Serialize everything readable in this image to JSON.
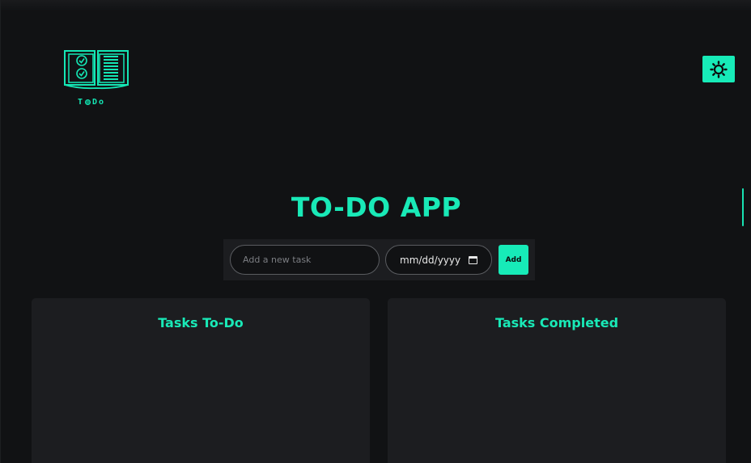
{
  "logo": {
    "text_left": "T",
    "text_right": "Do",
    "icon": "open-book-checklist-icon",
    "accent": "#14e7b5"
  },
  "theme_toggle": {
    "icon": "sun-icon",
    "color": "#17ebb8"
  },
  "title": "TO-DO APP",
  "form": {
    "task_placeholder": "Add a new task",
    "task_value": "",
    "date_placeholder": "mm/dd/yyyy",
    "date_icon": "calendar-icon",
    "add_label": "Add"
  },
  "panels": {
    "todo_title": "Tasks To-Do",
    "completed_title": "Tasks Completed"
  },
  "colors": {
    "background": "#111214",
    "panel": "#1c1d20",
    "accent": "#19e9b7"
  }
}
